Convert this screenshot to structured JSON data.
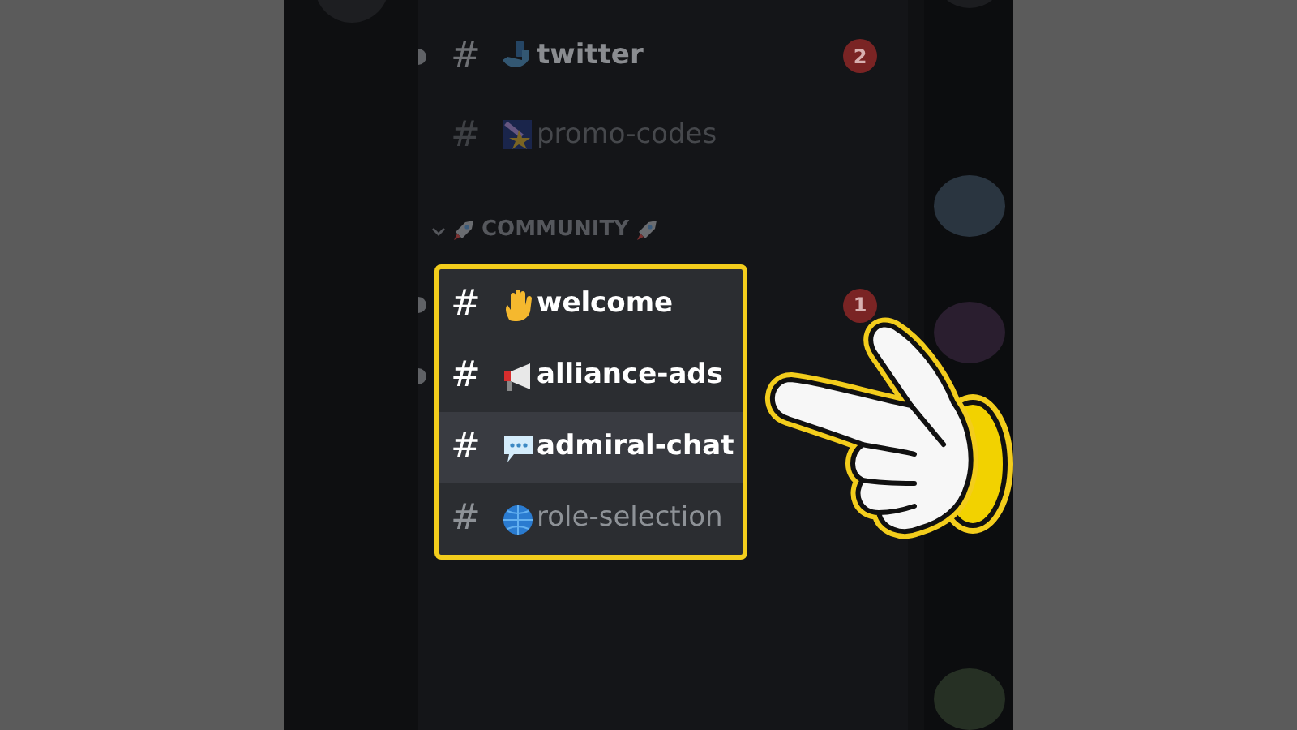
{
  "channels": [
    {
      "symbol": "#",
      "name": "twitter",
      "unread": true,
      "badge": "2"
    },
    {
      "symbol": "#",
      "name": "promo-codes",
      "unread": false
    }
  ],
  "category": {
    "label": "COMMUNITY",
    "expanded": true,
    "highlighted": true,
    "channels": [
      {
        "symbol": "#",
        "name": "welcome",
        "unread": true,
        "selected": false,
        "badge": "1"
      },
      {
        "symbol": "#",
        "name": "alliance-ads",
        "unread": true,
        "selected": false
      },
      {
        "symbol": "#",
        "name": "admiral-chat",
        "unread": false,
        "selected": true
      },
      {
        "symbol": "#",
        "name": "role-selection",
        "unread": false,
        "selected": false
      }
    ]
  }
}
